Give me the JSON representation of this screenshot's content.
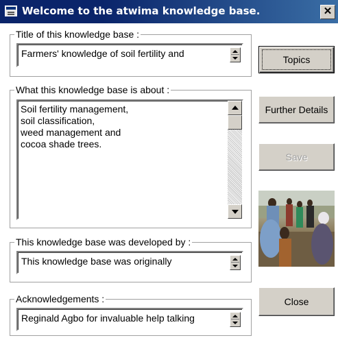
{
  "window": {
    "title": "Welcome to the atwima knowledge base.",
    "close_glyph": "✕"
  },
  "sections": {
    "title": {
      "label": "Title of this knowledge base :",
      "value": "Farmers' knowledge of soil fertility and"
    },
    "about": {
      "label": "What this knowledge base is about :",
      "lines": [
        "Soil fertility management,",
        "soil classification,",
        "weed management and",
        "cocoa shade trees."
      ]
    },
    "developed_by": {
      "label": "This knowledge base was developed by :",
      "value": "This knowledge base was originally"
    },
    "acknowledgements": {
      "label": "Acknowledgements :",
      "value": "Reginald Agbo for invaluable help talking"
    }
  },
  "buttons": {
    "topics": "Topics",
    "further_details": "Further Details",
    "save": "Save",
    "close": "Close"
  },
  "icons": {
    "app": "app-window-icon",
    "close": "close-icon",
    "spin": "spin-updown-icon",
    "scroll_up": "scroll-up-arrow-icon",
    "scroll_down": "scroll-down-arrow-icon"
  },
  "colors": {
    "titlebar": "#0a246a",
    "face": "#d4d0c8"
  }
}
